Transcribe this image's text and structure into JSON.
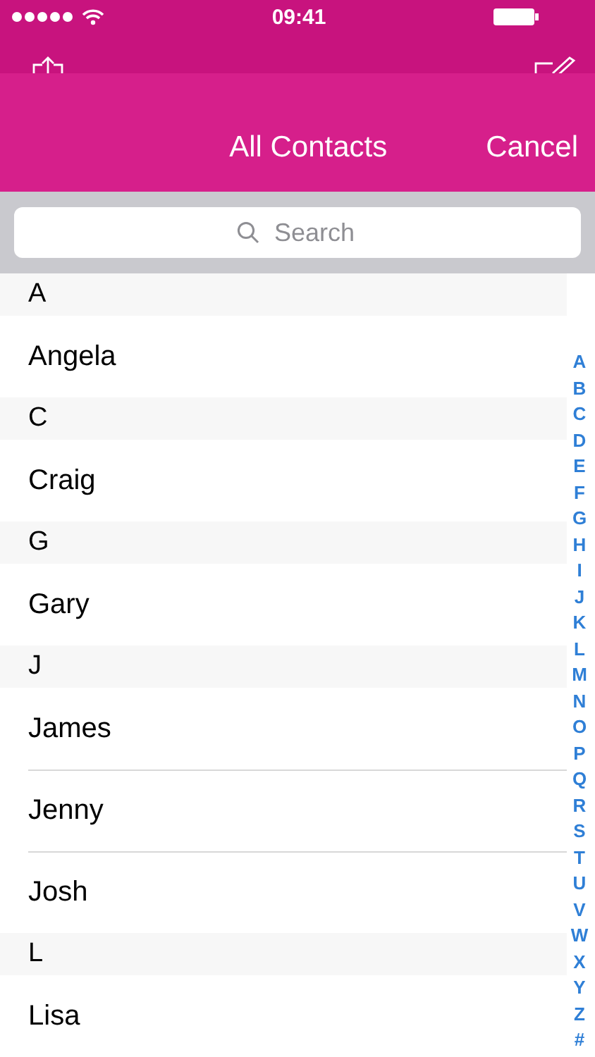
{
  "status_bar": {
    "time": "09:41"
  },
  "header": {
    "title": "All Contacts",
    "cancel": "Cancel"
  },
  "search": {
    "placeholder": "Search"
  },
  "sections": [
    {
      "letter": "A",
      "contacts": [
        "Angela"
      ]
    },
    {
      "letter": "C",
      "contacts": [
        "Craig"
      ]
    },
    {
      "letter": "G",
      "contacts": [
        "Gary"
      ]
    },
    {
      "letter": "J",
      "contacts": [
        "James",
        "Jenny",
        "Josh"
      ]
    },
    {
      "letter": "L",
      "contacts": [
        "Lisa"
      ]
    }
  ],
  "index": [
    "A",
    "B",
    "C",
    "D",
    "E",
    "F",
    "G",
    "H",
    "I",
    "J",
    "K",
    "L",
    "M",
    "N",
    "O",
    "P",
    "Q",
    "R",
    "S",
    "T",
    "U",
    "V",
    "W",
    "X",
    "Y",
    "Z",
    "#"
  ]
}
